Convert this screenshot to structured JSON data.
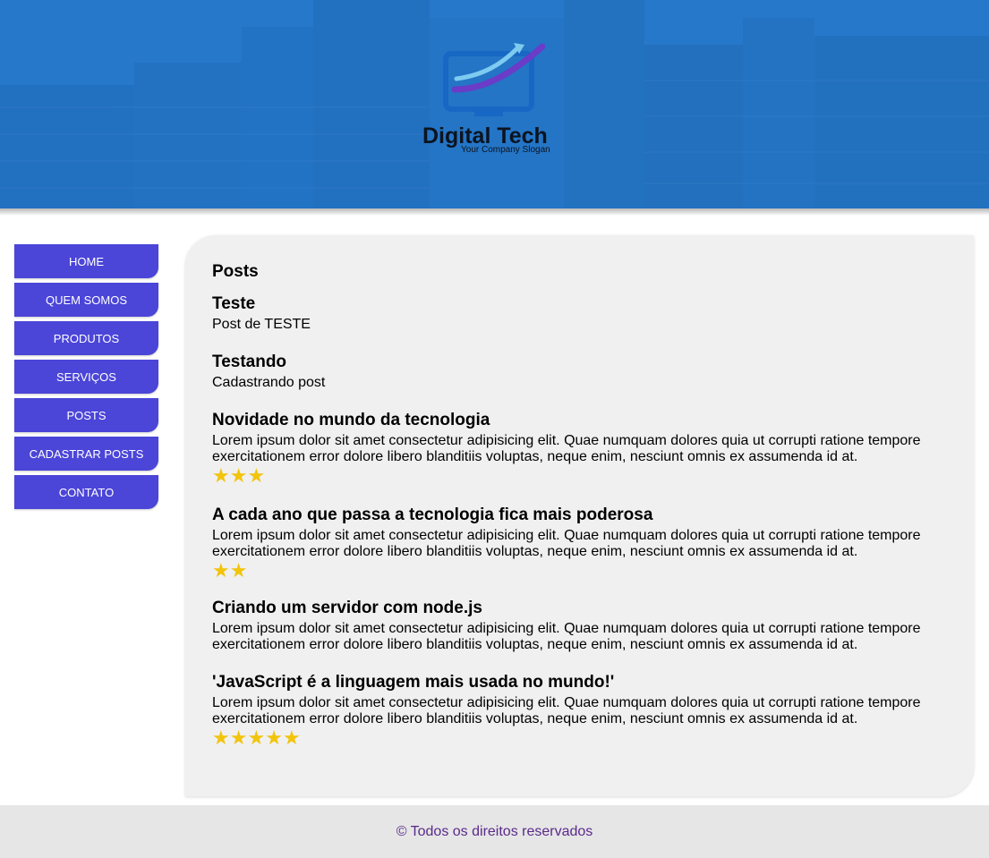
{
  "header": {
    "brand_name": "Digital Tech",
    "brand_slogan": "Your Company Slogan"
  },
  "nav": {
    "items": [
      {
        "label": "HOME"
      },
      {
        "label": "QUEM SOMOS"
      },
      {
        "label": "PRODUTOS"
      },
      {
        "label": "SERVIÇOS"
      },
      {
        "label": "POSTS"
      },
      {
        "label": "CADASTRAR POSTS"
      },
      {
        "label": "CONTATO"
      }
    ]
  },
  "main": {
    "title": "Posts",
    "posts": [
      {
        "title": "Teste",
        "body": "Post de TESTE",
        "stars": 0
      },
      {
        "title": "Testando",
        "body": "Cadastrando post",
        "stars": 0
      },
      {
        "title": "Novidade no mundo da tecnologia",
        "body": "Lorem ipsum dolor sit amet consectetur adipisicing elit. Quae numquam dolores quia ut corrupti ratione tempore exercitationem error dolore libero blanditiis voluptas, neque enim, nesciunt omnis ex assumenda id at.",
        "stars": 3
      },
      {
        "title": "A cada ano que passa a tecnologia fica mais poderosa",
        "body": "Lorem ipsum dolor sit amet consectetur adipisicing elit. Quae numquam dolores quia ut corrupti ratione tempore exercitationem error dolore libero blanditiis voluptas, neque enim, nesciunt omnis ex assumenda id at.",
        "stars": 2
      },
      {
        "title": "Criando um servidor com node.js",
        "body": "Lorem ipsum dolor sit amet consectetur adipisicing elit. Quae numquam dolores quia ut corrupti ratione tempore exercitationem error dolore libero blanditiis voluptas, neque enim, nesciunt omnis ex assumenda id at.",
        "stars": 0
      },
      {
        "title": "'JavaScript é a linguagem mais usada no mundo!'",
        "body": "Lorem ipsum dolor sit amet consectetur adipisicing elit. Quae numquam dolores quia ut corrupti ratione tempore exercitationem error dolore libero blanditiis voluptas, neque enim, nesciunt omnis ex assumenda id at.",
        "stars": 5
      }
    ]
  },
  "footer": {
    "text": "© Todos os direitos reservados"
  },
  "colors": {
    "nav_bg": "#4b45d8",
    "star": "#f2c40c",
    "footer_text": "#5a2a8c",
    "banner": "#1f6fc4"
  },
  "icons": {
    "rating": "star-icon",
    "logo": "monitor-arrow-logo"
  }
}
